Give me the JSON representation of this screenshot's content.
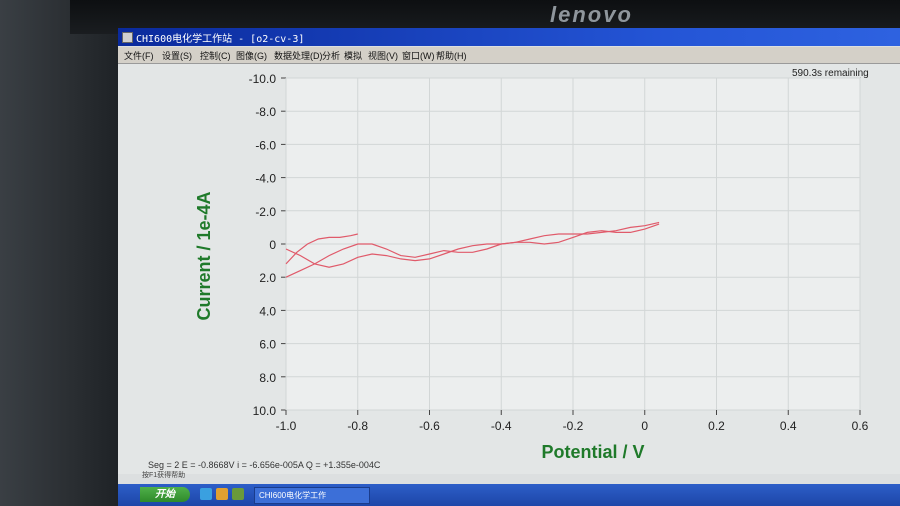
{
  "monitor": {
    "brand": "lenovo"
  },
  "window": {
    "title": "CHI600电化学工作站 - [o2-cv-3]"
  },
  "menu": [
    {
      "label": "文件(F)"
    },
    {
      "label": "设置(S)"
    },
    {
      "label": "控制(C)"
    },
    {
      "label": "图像(G)"
    },
    {
      "label": "数据处理(D)"
    },
    {
      "label": "分析"
    },
    {
      "label": "模拟"
    },
    {
      "label": "视图(V)"
    },
    {
      "label": "窗口(W)"
    },
    {
      "label": "帮助(H)"
    }
  ],
  "status": {
    "remaining": "590.3s remaining",
    "segment_line": "Seg = 2  E = -0.8668V  i = -6.656e-005A  Q = +1.355e-004C",
    "hint": "按F1获得帮助"
  },
  "taskbar": {
    "start_label": "开始",
    "task_label": "CHI600电化学工作"
  },
  "chart_data": {
    "type": "line",
    "xlabel": "Potential / V",
    "ylabel": "Current / 1e-4A",
    "xlim": [
      -1.0,
      0.6
    ],
    "ylim": [
      10.0,
      -10.0
    ],
    "x_ticks": [
      "-1.0",
      "-0.8",
      "-0.6",
      "-0.4",
      "-0.2",
      "0",
      "0.2",
      "0.4",
      "0.6"
    ],
    "y_ticks": [
      "-10.0",
      "-8.0",
      "-6.0",
      "-4.0",
      "-2.0",
      "0",
      "2.0",
      "4.0",
      "6.0",
      "8.0",
      "10.0"
    ],
    "grid": true,
    "line_color": "#e05a6a",
    "axis_label_color": "#1f7a2a",
    "series": [
      {
        "x": [
          -1.0,
          -0.97,
          -0.94,
          -0.91,
          -0.88,
          -0.85,
          -0.82,
          -0.8
        ],
        "y": [
          1.2,
          0.5,
          0.0,
          -0.3,
          -0.4,
          -0.4,
          -0.5,
          -0.6
        ]
      },
      {
        "x": [
          -1.0,
          -0.96,
          -0.92,
          -0.88,
          -0.84,
          -0.8,
          -0.76,
          -0.72,
          -0.68,
          -0.64,
          -0.6,
          -0.56,
          -0.52,
          -0.48,
          -0.44,
          -0.4,
          -0.36,
          -0.32,
          -0.28,
          -0.24,
          -0.2,
          -0.16,
          -0.12,
          -0.08,
          -0.04,
          0.0,
          0.04
        ],
        "y": [
          0.3,
          0.7,
          1.2,
          1.4,
          1.2,
          0.8,
          0.6,
          0.7,
          0.9,
          1.0,
          0.9,
          0.6,
          0.3,
          0.1,
          0.0,
          0.0,
          -0.1,
          -0.3,
          -0.5,
          -0.6,
          -0.6,
          -0.6,
          -0.7,
          -0.8,
          -1.0,
          -1.1,
          -1.3
        ]
      },
      {
        "x": [
          0.04,
          0.0,
          -0.04,
          -0.08,
          -0.12,
          -0.16,
          -0.2,
          -0.24,
          -0.28,
          -0.32,
          -0.36,
          -0.4,
          -0.44,
          -0.48,
          -0.52,
          -0.56,
          -0.6,
          -0.64,
          -0.68,
          -0.72,
          -0.76,
          -0.8,
          -0.84,
          -0.88,
          -0.92,
          -0.96,
          -1.0
        ],
        "y": [
          -1.2,
          -0.9,
          -0.7,
          -0.7,
          -0.8,
          -0.7,
          -0.4,
          -0.1,
          0.0,
          -0.1,
          -0.1,
          0.0,
          0.3,
          0.5,
          0.5,
          0.4,
          0.6,
          0.8,
          0.7,
          0.3,
          0.0,
          0.0,
          0.3,
          0.7,
          1.2,
          1.6,
          2.0
        ]
      }
    ]
  }
}
